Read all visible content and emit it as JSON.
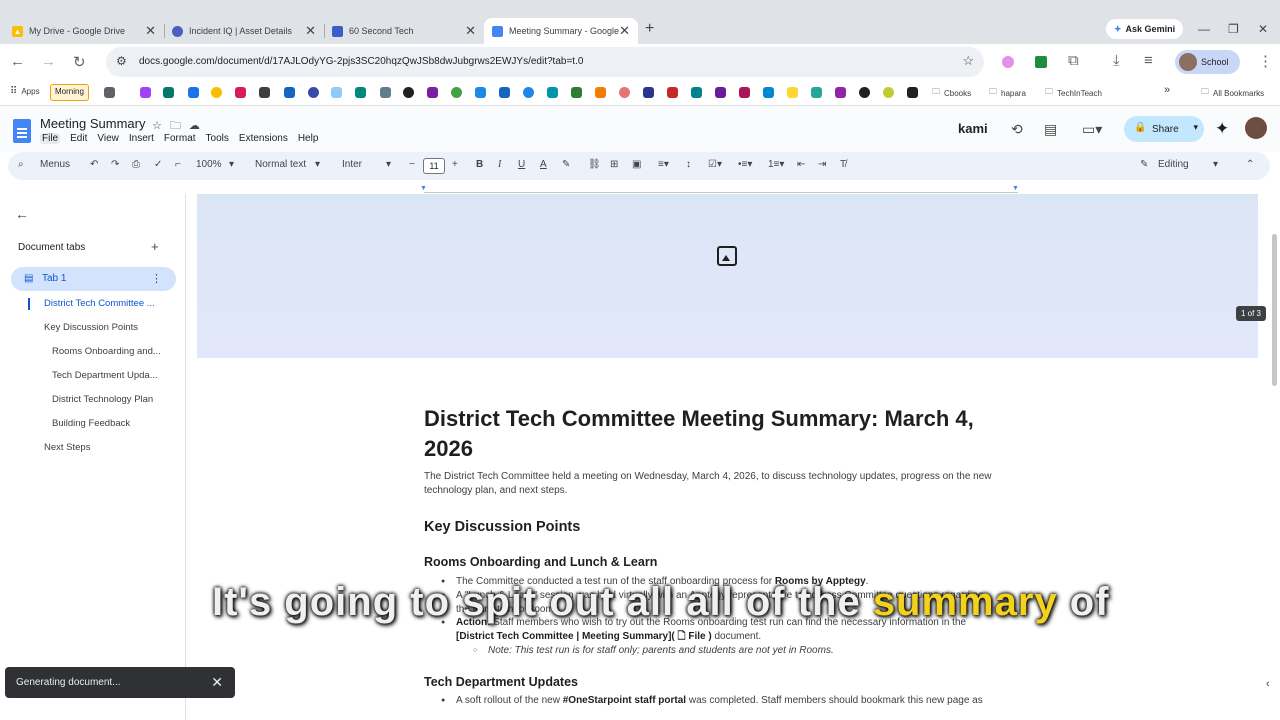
{
  "browser": {
    "tabs": [
      {
        "title": "My Drive - Google Drive",
        "color": "#fbbc04"
      },
      {
        "title": "Incident IQ | Asset Details",
        "color": "#4a5fc1"
      },
      {
        "title": "60 Second Tech",
        "color": "#3c5ec9"
      },
      {
        "title": "Meeting Summary - Google",
        "color": "#4285f4"
      }
    ],
    "ask_gemini": "Ask Gemini",
    "url": "docs.google.com/document/d/17AJLOdyYG-2pjs3SC20hqzQwJSb8dwJubgrws2EWJYs/edit?tab=t.0",
    "profile": "School",
    "bookmarks": {
      "apps": "Apps",
      "morning": "Morning",
      "cbooks": "Cbooks",
      "hapara": "hapara",
      "techinteach": "TechInTeach",
      "all": "All Bookmarks"
    }
  },
  "docs": {
    "title": "Meeting Summary",
    "menus": [
      "File",
      "Edit",
      "View",
      "Insert",
      "Format",
      "Tools",
      "Extensions",
      "Help"
    ],
    "kami": "kami",
    "share": "Share",
    "toolbar": {
      "menus": "Menus",
      "zoom": "100%",
      "style": "Normal text",
      "font": "Inter",
      "font_size": "11",
      "mode": "Editing"
    }
  },
  "sidebar": {
    "header": "Document tabs",
    "tab": "Tab 1",
    "outline": [
      "District Tech Committee ...",
      "Key Discussion Points",
      "Rooms Onboarding and...",
      "Tech Department Upda...",
      "District Technology Plan",
      "Building Feedback",
      "Next Steps"
    ]
  },
  "document": {
    "page_badge": "1 of 3",
    "heading": "District Tech Committee Meeting Summary: March 4, 2026",
    "intro": "The District Tech Committee held a meeting on Wednesday, March 4, 2026, to discuss technology updates, progress on the new technology plan, and next steps.",
    "section1": "Key Discussion Points",
    "sub1": "Rooms Onboarding and Lunch & Learn",
    "b1_pre": "The Committee conducted a test run of the staff onboarding process for ",
    "b1_bold": "Rooms by Apptegy",
    "b1_post": ".",
    "b2": "A \"Lunch & Learn\" session was held virtually with an Apptegy representative to address Committee questions regarding",
    "b2_cont": "the transition to Rooms.",
    "b3_bold": "Action:",
    "b3": " Staff members who wish to try out the Rooms onboarding test run can find the necessary information in the",
    "b3_link": "[District Tech Committee | Meeting Summary]( 🗋 File )",
    "b3_post": " document.",
    "note": "Note: This test run is for staff only; parents and students are not yet in Rooms.",
    "sub2": "Tech Department Updates",
    "b4_pre": "A soft rollout of the new ",
    "b4_bold": "#OneStarpoint staff portal",
    "b4_post": " was completed. Staff members should bookmark this new page as"
  },
  "caption": {
    "main": "It's going to spit out all all of the ",
    "highlight": "summary",
    "end": " of"
  },
  "toast": {
    "text": "Generating document..."
  }
}
